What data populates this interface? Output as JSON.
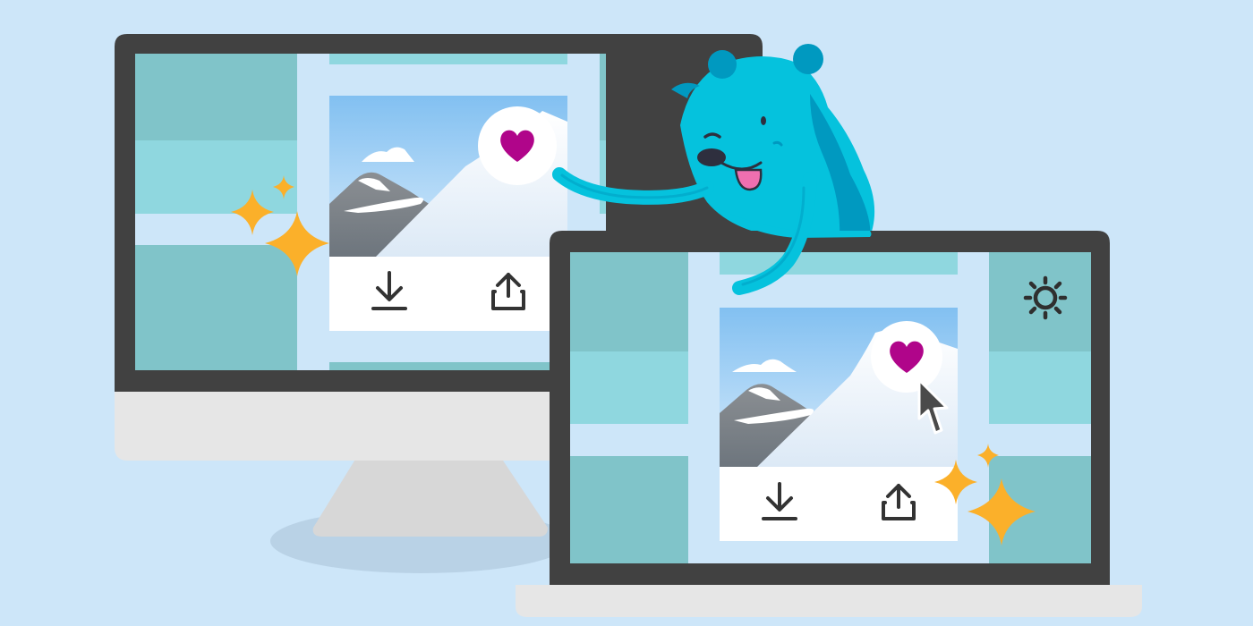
{
  "colors": {
    "background": "#cde6f9",
    "bezel": "#414141",
    "monitor_chin": "#e6e6e6",
    "stand": "#d7d7d7",
    "stand_shadow": "#b9d2e6",
    "tile_dark": "#80c4c9",
    "tile_light": "#8fd7df",
    "screen_bg": "#cde6f9",
    "card_white": "#ffffff",
    "sky_top": "#82c0f1",
    "sky_bottom": "#cfe6fa",
    "mountain_grey": "#848c93",
    "snow": "#ffffff",
    "heart": "#b0058a",
    "icon_dark": "#333333",
    "sparkle": "#fbb02a",
    "mascot_body": "#05c2dd",
    "mascot_shade": "#0099c0",
    "mascot_tongue": "#ef6fb0",
    "mascot_nose": "#2e2f3e"
  },
  "icons": {
    "like": "heart-icon",
    "download": "download-icon",
    "share": "share-icon",
    "settings": "gear-icon",
    "pointer": "cursor-arrow-icon",
    "decoration": "sparkle-icon",
    "character": "bear-mascot"
  }
}
